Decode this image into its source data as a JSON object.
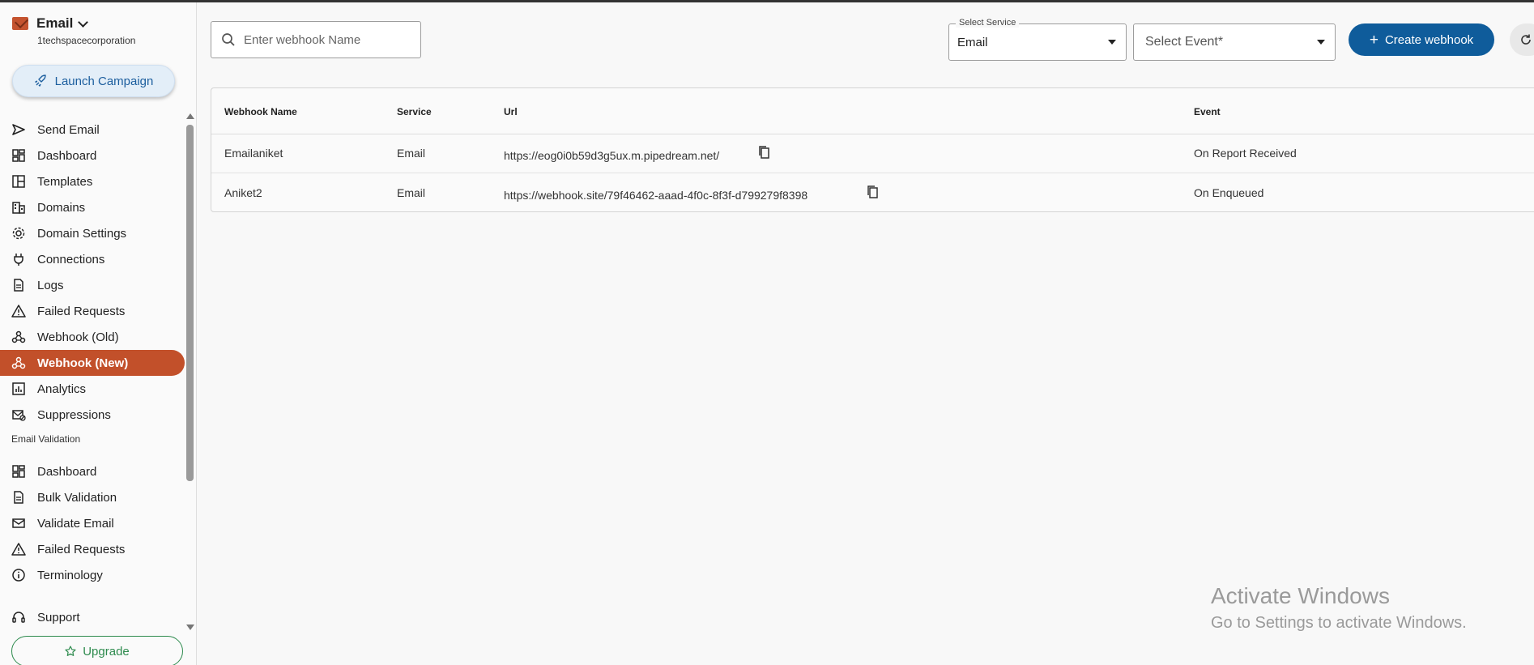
{
  "brand": {
    "title": "Email",
    "org": "1techspacecorporation",
    "launch_label": "Launch Campaign"
  },
  "nav": [
    {
      "label": "Send Email",
      "icon": "send-icon"
    },
    {
      "label": "Dashboard",
      "icon": "dashboard-icon"
    },
    {
      "label": "Templates",
      "icon": "templates-icon"
    },
    {
      "label": "Domains",
      "icon": "domains-icon"
    },
    {
      "label": "Domain Settings",
      "icon": "gear-icon"
    },
    {
      "label": "Connections",
      "icon": "plug-icon"
    },
    {
      "label": "Logs",
      "icon": "document-icon"
    },
    {
      "label": "Failed Requests",
      "icon": "warning-icon"
    },
    {
      "label": "Webhook (Old)",
      "icon": "webhook-icon"
    },
    {
      "label": "Webhook (New)",
      "icon": "webhook-icon",
      "active": true
    },
    {
      "label": "Analytics",
      "icon": "analytics-icon"
    },
    {
      "label": "Suppressions",
      "icon": "suppression-icon"
    }
  ],
  "validation_section": {
    "label": "Email Validation",
    "items": [
      {
        "label": "Dashboard",
        "icon": "dashboard-icon"
      },
      {
        "label": "Bulk Validation",
        "icon": "document-icon"
      },
      {
        "label": "Validate Email",
        "icon": "mail-icon"
      },
      {
        "label": "Failed Requests",
        "icon": "warning-icon"
      },
      {
        "label": "Terminology",
        "icon": "info-icon"
      }
    ]
  },
  "support_label": "Support",
  "upgrade_label": "Upgrade",
  "toolbar": {
    "search_placeholder": "Enter webhook Name",
    "service_label": "Select Service",
    "service_value": "Email",
    "event_placeholder": "Select Event*",
    "create_label": "Create webhook"
  },
  "table": {
    "headers": [
      "Webhook Name",
      "Service",
      "Url",
      "Event"
    ],
    "rows": [
      {
        "name": "Emailaniket",
        "service": "Email",
        "url": "https://eog0i0b59d3g5ux.m.pipedream.net/",
        "event": "On Report Received"
      },
      {
        "name": "Aniket2",
        "service": "Email",
        "url": "https://webhook.site/79f46462-aaad-4f0c-8f3f-d799279f8398",
        "event": "On Enqueued"
      }
    ]
  },
  "watermark": {
    "line1": "Activate Windows",
    "line2": "Go to Settings to activate Windows."
  },
  "colors": {
    "active_nav": "#c2502a",
    "primary_button": "#0f5c9b",
    "upgrade": "#2e8b4e"
  }
}
